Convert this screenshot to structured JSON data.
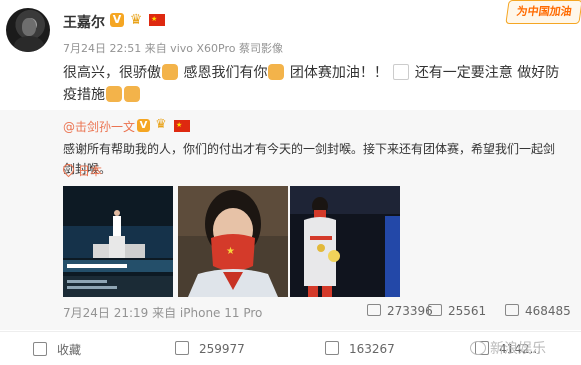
{
  "post": {
    "author": "王嘉尔",
    "verified_mark": "V",
    "meta": "7月24日 22:51 来自 vivo X60Pro 蔡司影像",
    "text_1": "很高兴，很骄傲",
    "text_2": "感恩我们有你",
    "text_3": "团体赛加油！！",
    "text_4": "还有一定要注意 做好防疫措施"
  },
  "campaign_badge": "为中国加油",
  "repost": {
    "author": "@击剑孙一文",
    "verified_mark": "V",
    "text": "感谢所有帮助我的人，你们的付出才有今天的一剑封喉。接下来还有团体赛，希望我们一起剑剑封喉。",
    "location": "日本",
    "meta": "7月24日 21:19 来自 iPhone 11 Pro",
    "stats": {
      "repost_count": "273396",
      "comment_count": "25561",
      "like_count": "468485"
    }
  },
  "footer": {
    "favorite_label": "收藏",
    "repost_count": "259977",
    "comment_count": "163267",
    "like_count": "4142..."
  },
  "watermark": "新浪娱乐",
  "colors": {
    "link": "#eb7350",
    "meta_gray": "#939393",
    "repost_bg": "#f7f7f7",
    "verified": "#f5a623",
    "flag_red": "#de2910"
  },
  "icons": [
    "crown-icon",
    "china-flag-icon",
    "pray-hands-icon",
    "fencing-icon",
    "location-pin-icon",
    "repost-icon",
    "comment-icon",
    "like-icon",
    "favorite-icon"
  ]
}
